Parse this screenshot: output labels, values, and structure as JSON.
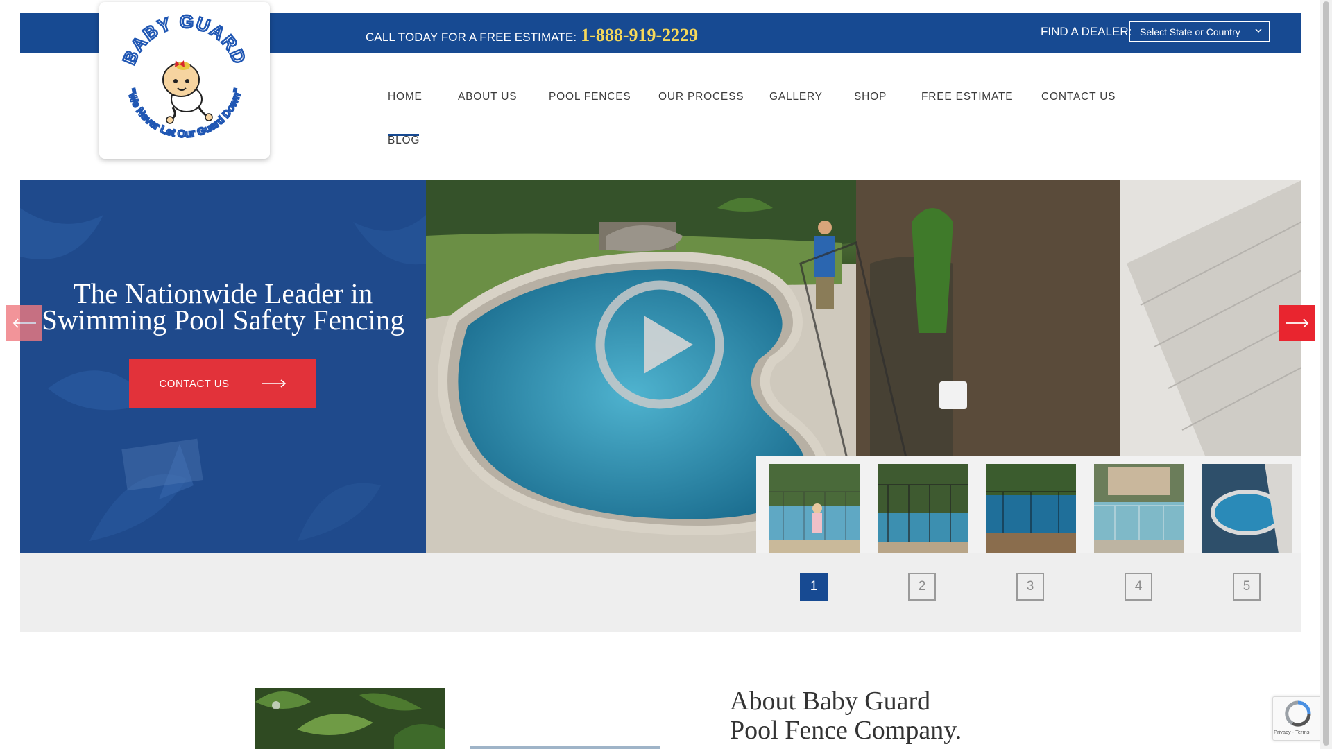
{
  "header": {
    "estimate_label": "CALL TODAY FOR A FREE ESTIMATE:",
    "phone": "1-888-919-2229",
    "dealer_label": "FIND A DEALER:",
    "dealer_select_value": "Select State or Country"
  },
  "logo": {
    "brand": "BABY GUARD",
    "tagline": "We Never Let Our Guard Down"
  },
  "nav": {
    "items": [
      "HOME",
      "ABOUT US",
      "POOL FENCES",
      "OUR PROCESS",
      "GALLERY",
      "SHOP",
      "FREE ESTIMATE",
      "CONTACT US",
      "BLOG"
    ],
    "active": "BLOG"
  },
  "hero": {
    "title_line1": "The Nationwide Leader in",
    "title_line2": "Swimming Pool Safety Fencing",
    "cta_label": "CONTACT US"
  },
  "slider": {
    "pages": [
      "1",
      "2",
      "3",
      "4",
      "5"
    ],
    "active_page": "1"
  },
  "about": {
    "title_line1": "About Baby Guard",
    "title_line2": "Pool Fence Company."
  },
  "recaptcha": {
    "privacy": "Privacy",
    "terms": "Terms"
  },
  "colors": {
    "brand_blue": "#174a92",
    "accent_red": "#e2323a",
    "phone_yellow": "#f5d85a"
  }
}
